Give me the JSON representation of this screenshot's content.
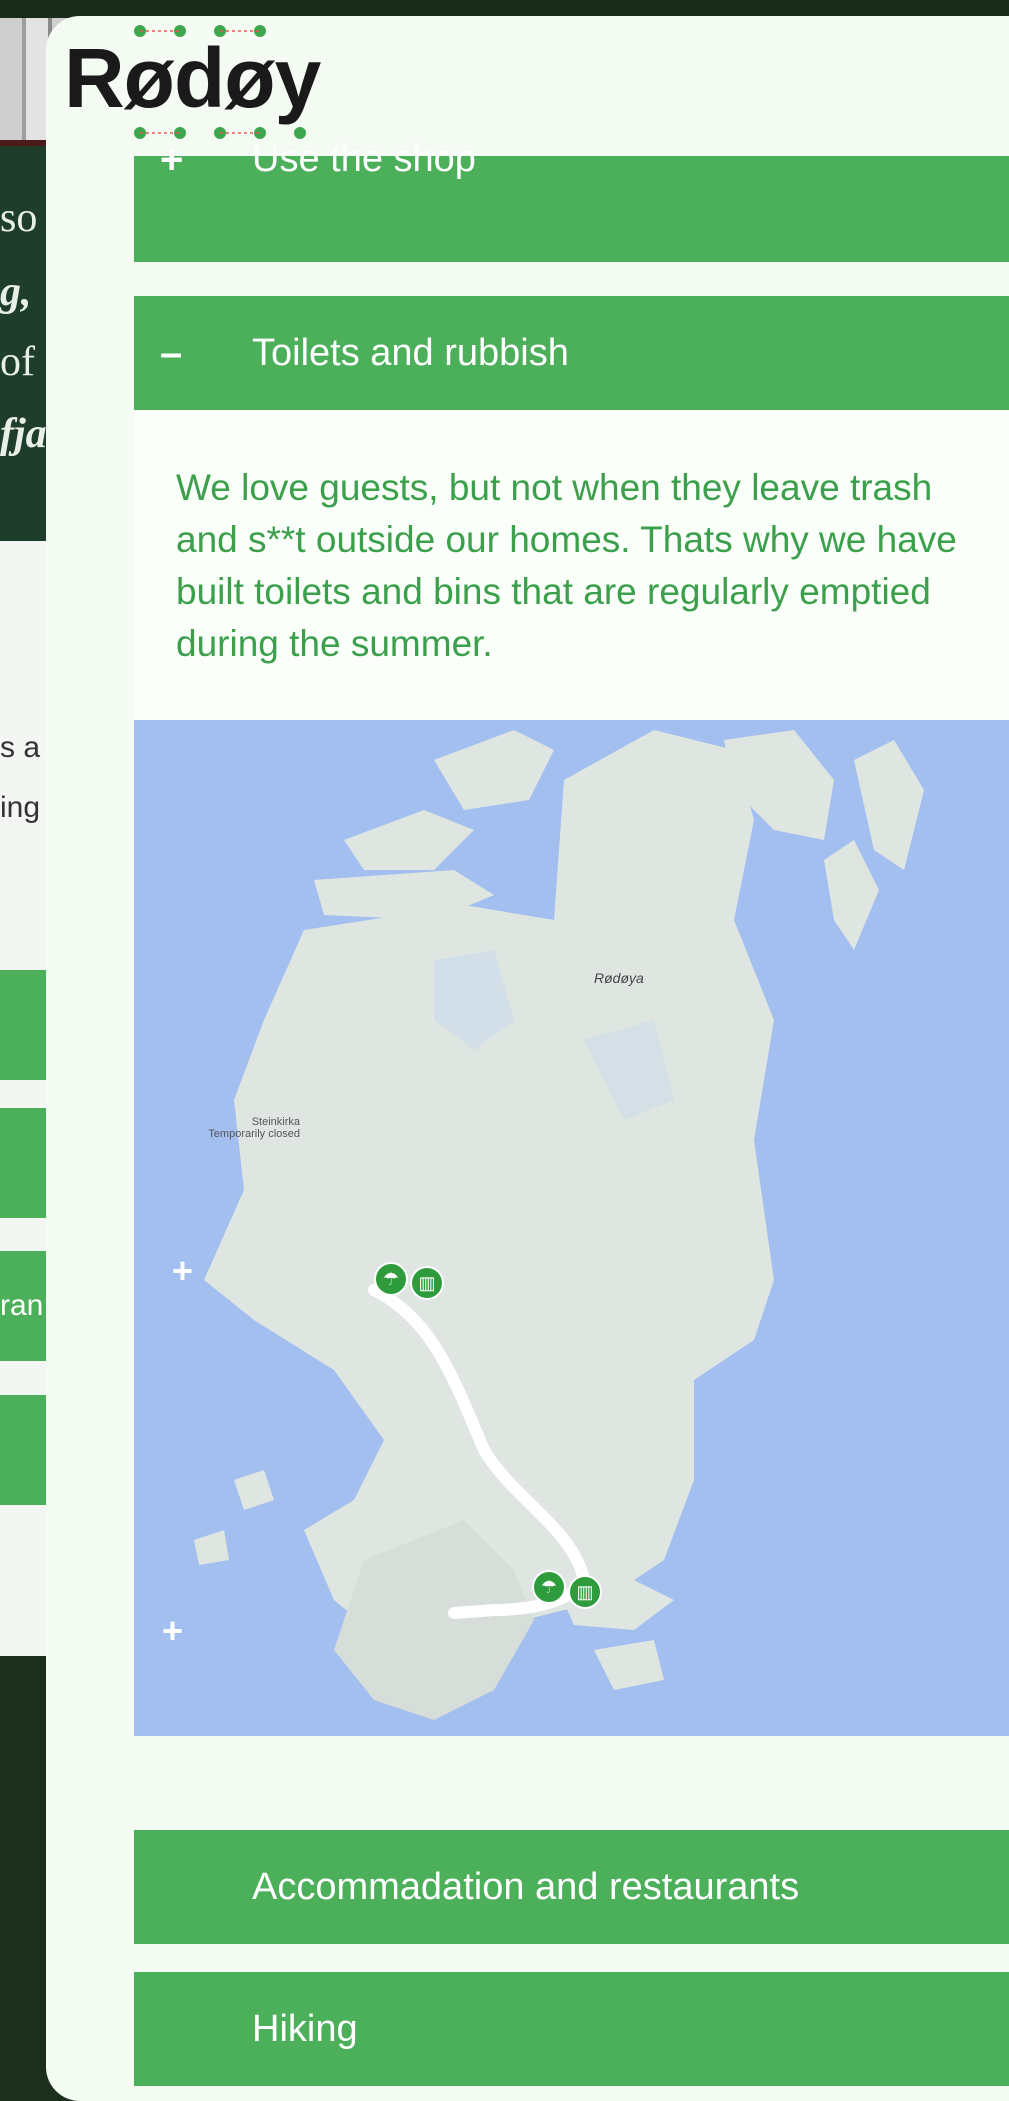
{
  "logo": {
    "text": "Rødøy"
  },
  "background": {
    "dark_lines": [
      "so",
      "g,",
      "of",
      "fja"
    ],
    "light_lines": [
      "s a",
      "ing"
    ],
    "green_fragment": "ran"
  },
  "accordion": {
    "shop": {
      "sign": "+",
      "label": "Use the shop"
    },
    "toilets": {
      "sign": "–",
      "label": "Toilets and rubbish",
      "body": "We love guests, but not when they leave trash and s**t outside our homes. Thats why we have built toilets and bins that are regularly emptied during the summer."
    },
    "accommodation": {
      "label": "Accommadation and restaurants"
    },
    "hiking": {
      "label": "Hiking"
    }
  },
  "map": {
    "place_label": "Rødøya",
    "church_label_1": "Steinkirka",
    "church_label_2": "Temporarily closed",
    "plus": "+",
    "colors": {
      "water": "#a3bff0",
      "land": "#dfe6e1",
      "route": "#ffffff",
      "pin": "#2e9c3d"
    }
  },
  "colors": {
    "accent": "#4caf5a",
    "text_green": "#3b9f4c",
    "panel": "#f4fbf3"
  }
}
